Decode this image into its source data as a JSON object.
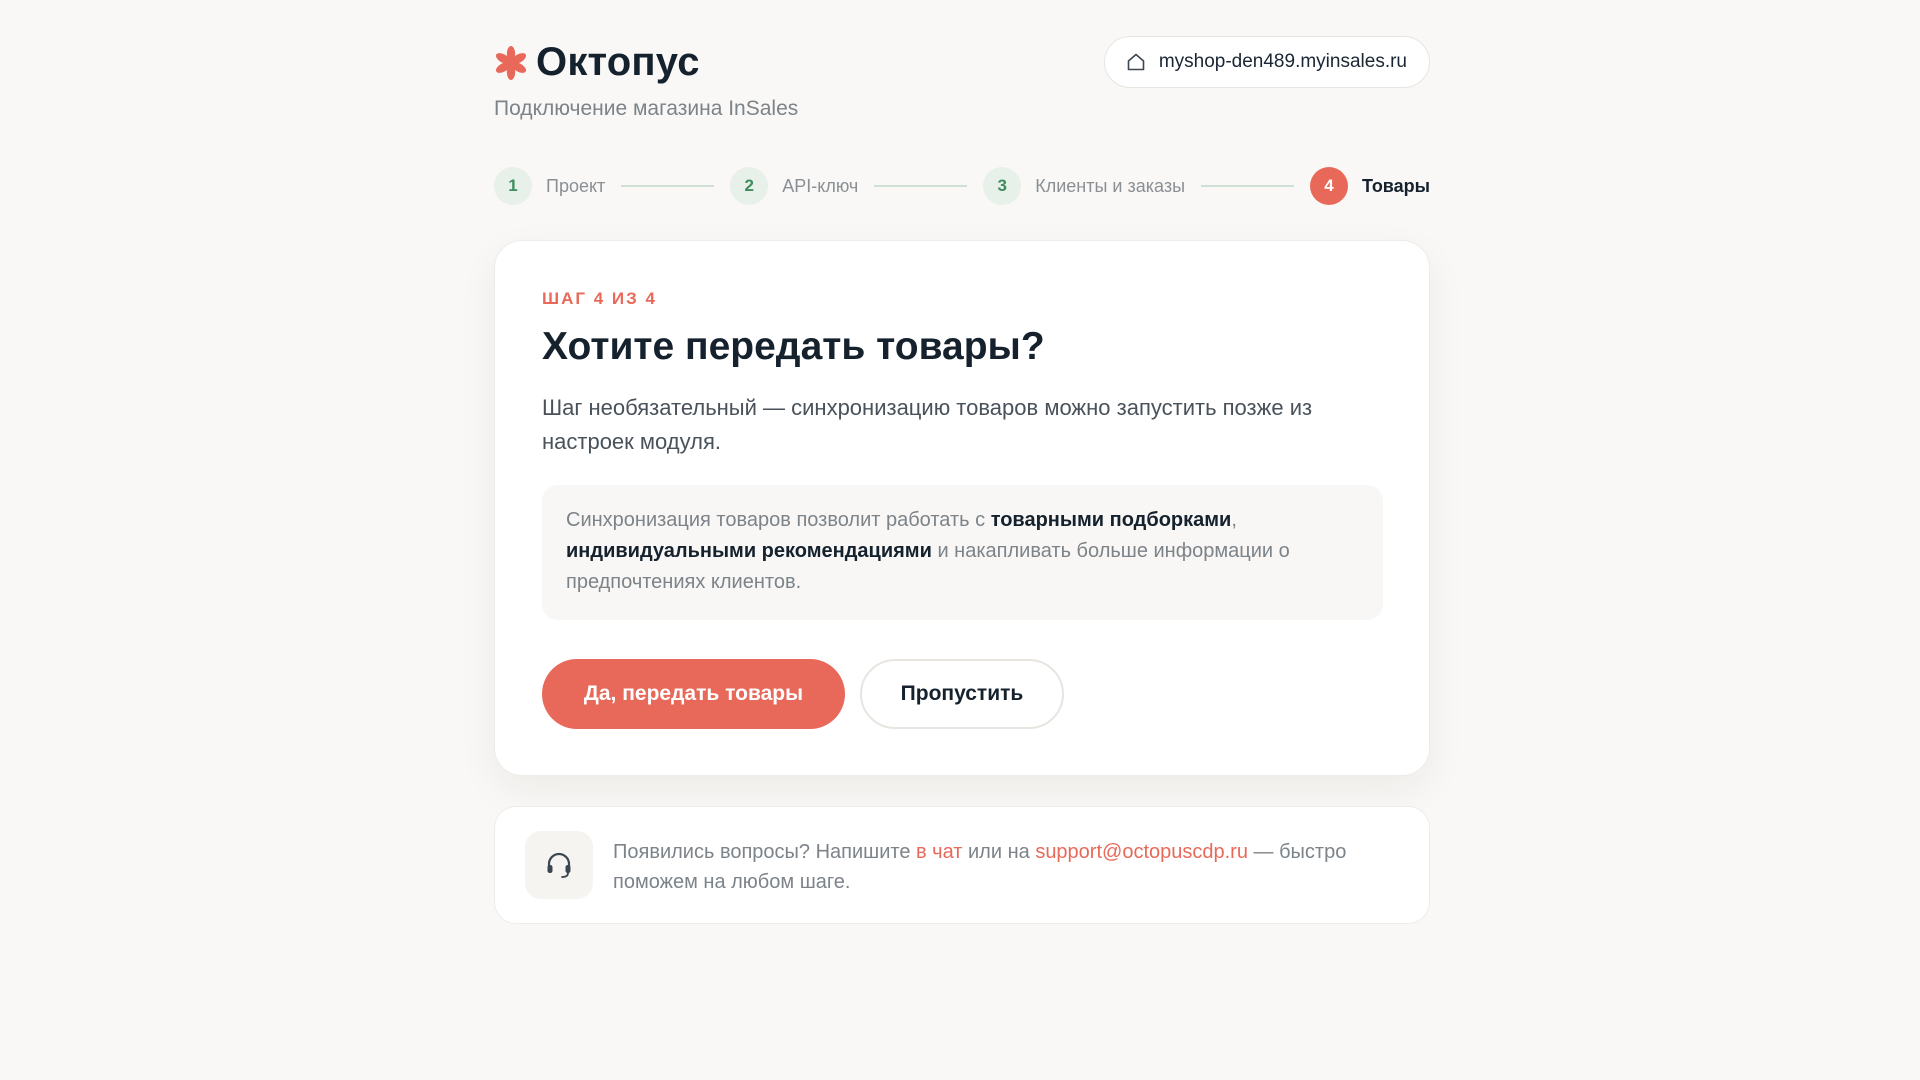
{
  "header": {
    "brand": "Октопус",
    "subtitle": "Подключение магазина InSales",
    "shop_domain": "myshop-den489.myinsales.ru",
    "brand_icon": "asterisk-logo-icon",
    "shop_icon": "home-icon"
  },
  "stepper": {
    "steps": [
      {
        "num": "1",
        "label": "Проект",
        "state": "done"
      },
      {
        "num": "2",
        "label": "API-ключ",
        "state": "done"
      },
      {
        "num": "3",
        "label": "Клиенты и заказы",
        "state": "done"
      },
      {
        "num": "4",
        "label": "Товары",
        "state": "active"
      }
    ]
  },
  "card": {
    "eyebrow": "ШАГ 4 ИЗ 4",
    "title": "Хотите передать товары?",
    "description": "Шаг необязательный — синхронизацию товаров можно запустить позже из настроек модуля.",
    "info": {
      "part1": "Синхронизация товаров позволит работать с ",
      "bold1": "товарными подборками",
      "part2": ", ",
      "bold2": "индивидуальными рекомендациями",
      "part3": " и накапливать больше информации о предпочтениях клиентов."
    },
    "primary_button": "Да, передать товары",
    "secondary_button": "Пропустить"
  },
  "help": {
    "icon": "headset-icon",
    "text1": "Появились вопросы? Напишите ",
    "chat_link": "в чат",
    "text2": " или на ",
    "email_link": "support@octopuscdp.ru",
    "text3": " — быстро поможем на любом шаге."
  },
  "colors": {
    "accent": "#e8695a",
    "done_step": "#3e8d5d",
    "background": "#f9f8f6"
  }
}
